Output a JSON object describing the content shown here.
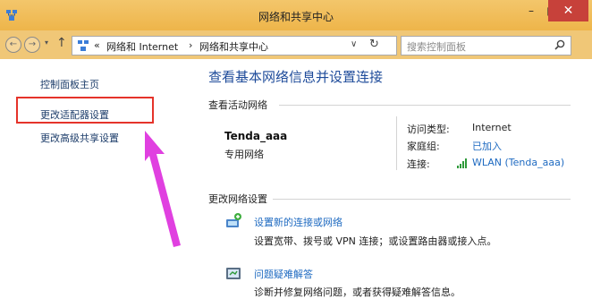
{
  "window": {
    "title": "网络和共享中心",
    "controls": {
      "minimize": "–",
      "maximize": "□",
      "close": "✕"
    }
  },
  "nav": {
    "back_icon": "back-arrow-icon",
    "forward_icon": "forward-arrow-icon",
    "up_icon": "up-arrow-icon",
    "breadcrumb": {
      "overflow": "«",
      "items": [
        "网络和 Internet",
        "网络和共享中心"
      ],
      "separator": "›"
    },
    "search_placeholder": "搜索控制面板"
  },
  "sidebar": {
    "items": [
      {
        "label": "控制面板主页"
      },
      {
        "label": "更改适配器设置",
        "highlighted": true
      },
      {
        "label": "更改高级共享设置"
      }
    ]
  },
  "main": {
    "heading": "查看基本网络信息并设置连接",
    "active_section": "查看活动网络",
    "network": {
      "name": "Tenda_aaa",
      "type": "专用网络",
      "access_type_label": "访问类型:",
      "access_type_value": "Internet",
      "homegroup_label": "家庭组:",
      "homegroup_value": "已加入",
      "connection_label": "连接:",
      "connection_value": "WLAN (Tenda_aaa)"
    },
    "change_section": "更改网络设置",
    "tasks": [
      {
        "title": "设置新的连接或网络",
        "desc": "设置宽带、拨号或 VPN 连接；或设置路由器或接入点。"
      },
      {
        "title": "问题疑难解答",
        "desc": "诊断并修复网络问题，或者获得疑难解答信息。"
      }
    ]
  },
  "colors": {
    "titlebar": "#eeb54a",
    "close_button": "#c7413a",
    "link": "#1e6ac1",
    "heading": "#1e4b9a",
    "highlight": "#e5332a",
    "annotation_arrow": "#e040e0"
  }
}
